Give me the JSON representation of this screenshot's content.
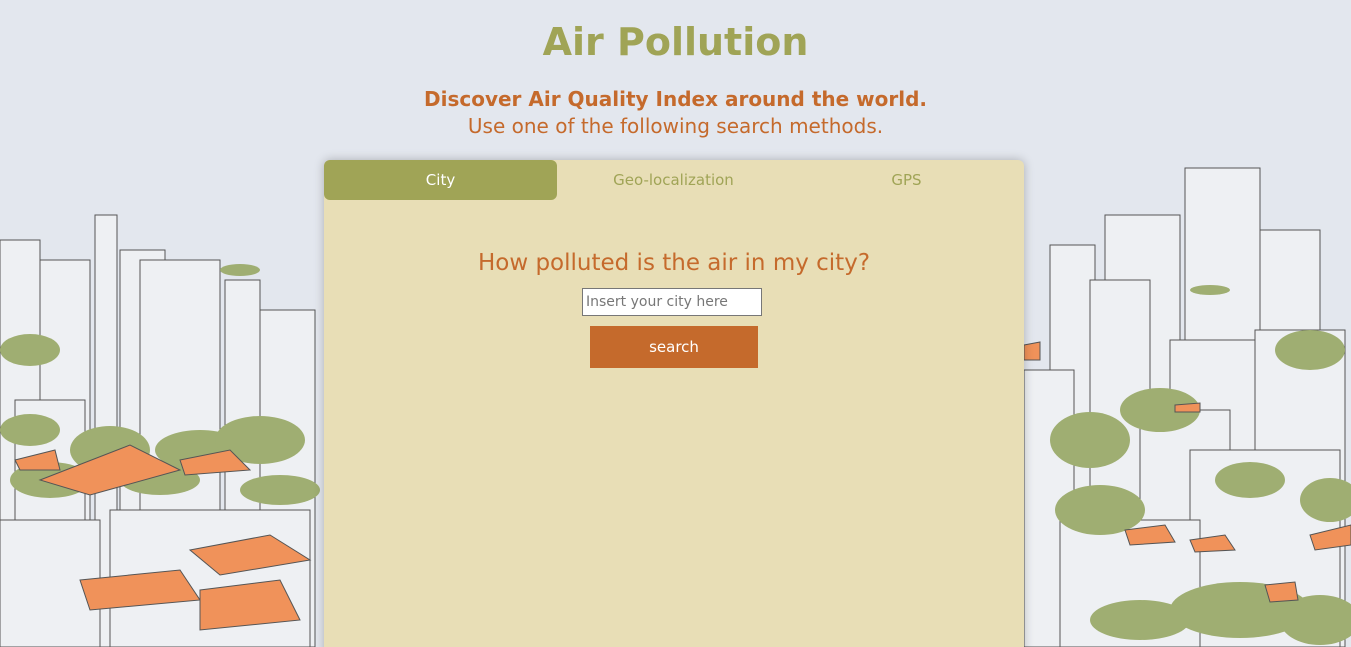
{
  "header": {
    "title": "Air Pollution",
    "subtitle": "Discover Air Quality Index around the world.",
    "subtitle2": "Use one of the following search methods."
  },
  "tabs": [
    {
      "label": "City",
      "active": true
    },
    {
      "label": "Geo-localization",
      "active": false
    },
    {
      "label": "GPS",
      "active": false
    }
  ],
  "city_search": {
    "question": "How polluted is the air in my city?",
    "input_placeholder": "Insert your city here",
    "input_value": "",
    "button_label": "search"
  },
  "colors": {
    "background": "#e3e7ee",
    "olive": "#a0a456",
    "orange": "#c56a2c",
    "panel": "#e8deb6"
  }
}
